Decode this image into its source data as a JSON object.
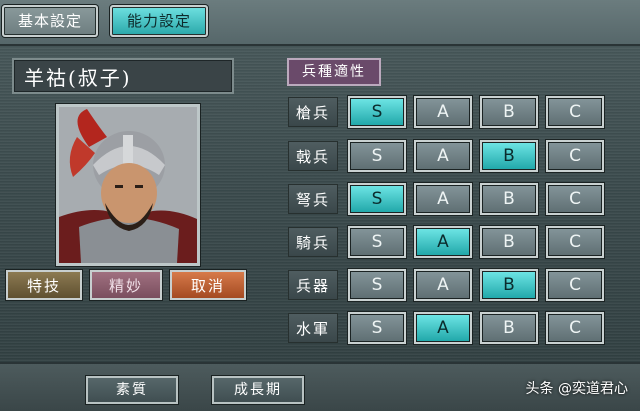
{
  "tabs": [
    {
      "label": "基本設定",
      "active": false
    },
    {
      "label": "能力設定",
      "active": true
    }
  ],
  "character": {
    "name": "羊祜(叔子)"
  },
  "actions": {
    "tokugi": "特技",
    "seimyo": "精妙",
    "torikeshi": "取消"
  },
  "aptitude": {
    "header": "兵種適性",
    "grades": [
      "S",
      "A",
      "B",
      "C"
    ],
    "rows": [
      {
        "unit": "槍兵",
        "selected": "S"
      },
      {
        "unit": "戟兵",
        "selected": "B"
      },
      {
        "unit": "弩兵",
        "selected": "S"
      },
      {
        "unit": "騎兵",
        "selected": "A"
      },
      {
        "unit": "兵器",
        "selected": "B"
      },
      {
        "unit": "水軍",
        "selected": "A"
      }
    ]
  },
  "bottom": {
    "soshitsu": "素質",
    "seichoki": "成長期",
    "watermark": "头条 @奕道君心"
  },
  "colors": {
    "active_teal": "#2aa8aa",
    "panel_gray": "#3b4a4c"
  }
}
